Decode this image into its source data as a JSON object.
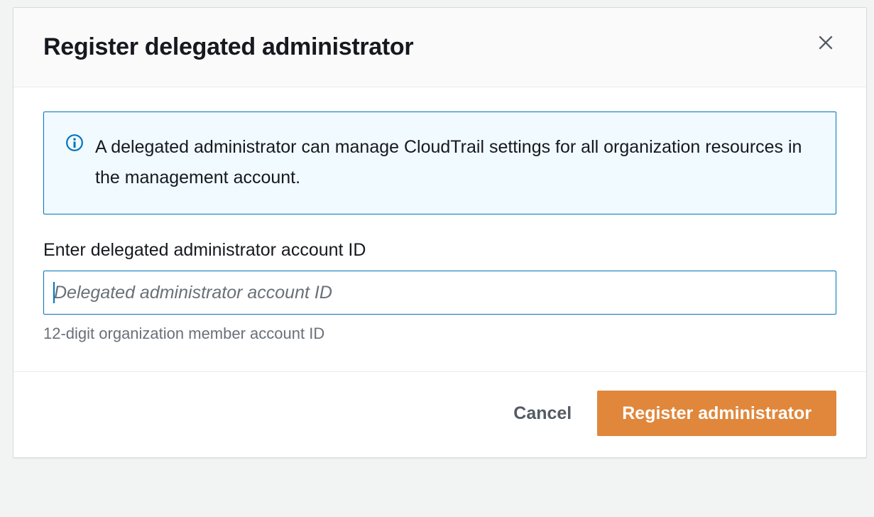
{
  "modal": {
    "title": "Register delegated administrator",
    "info_message": "A delegated administrator can manage CloudTrail settings for all organization resources in the management account.",
    "form": {
      "label": "Enter delegated administrator account ID",
      "placeholder": "Delegated administrator account ID",
      "value": "",
      "help": "12-digit organization member account ID"
    },
    "actions": {
      "cancel": "Cancel",
      "submit": "Register administrator"
    }
  }
}
